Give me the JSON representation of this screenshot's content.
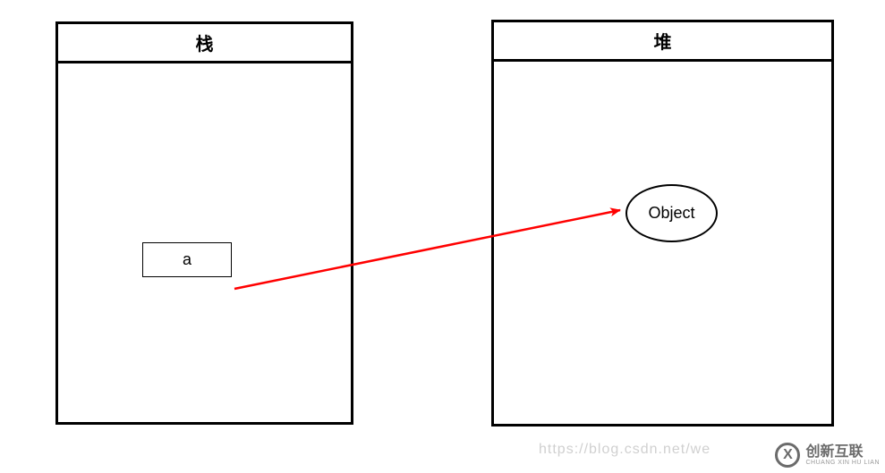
{
  "stack_panel": {
    "title": "栈",
    "variable": {
      "name": "a"
    }
  },
  "heap_panel": {
    "title": "堆",
    "object": {
      "label": "Object"
    }
  },
  "arrow": {
    "from": "stack.a",
    "to": "heap.Object",
    "color": "#ff0000"
  },
  "watermark": {
    "url_text": "https://blog.csdn.net/we",
    "logo_cn": "创新互联",
    "logo_py": "CHUANG XIN HU LIAN",
    "logo_glyph": "X"
  },
  "chart_data": {
    "type": "diagram",
    "description": "Memory model: stack variable 'a' references an Object on the heap",
    "nodes": [
      {
        "id": "stack",
        "label": "栈",
        "kind": "region"
      },
      {
        "id": "heap",
        "label": "堆",
        "kind": "region"
      },
      {
        "id": "a",
        "label": "a",
        "kind": "variable",
        "parent": "stack"
      },
      {
        "id": "obj",
        "label": "Object",
        "kind": "object",
        "parent": "heap"
      }
    ],
    "edges": [
      {
        "from": "a",
        "to": "obj",
        "kind": "reference"
      }
    ]
  }
}
